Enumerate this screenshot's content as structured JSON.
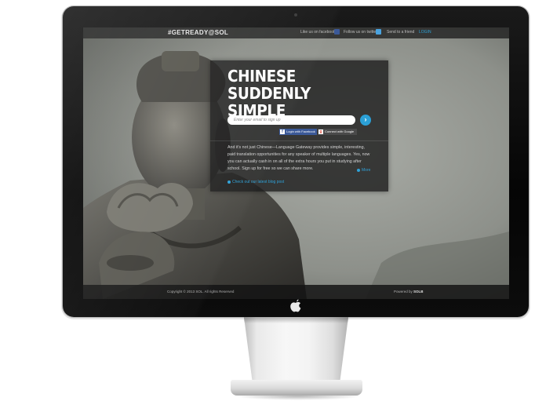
{
  "site": {
    "brand": "#GETREADY@SOL",
    "top_links": [
      {
        "label": "Like us on facebook",
        "icon": "facebook-icon"
      },
      {
        "label": "Follow us on twitter",
        "icon": "twitter-icon"
      },
      {
        "label": "Send to a friend",
        "icon": ""
      },
      {
        "label": "LOGIN",
        "icon": ""
      }
    ]
  },
  "hero": {
    "headline_line1": "CHINESE",
    "headline_line2": "SUDDENLY SIMPLE",
    "email_placeholder": "Enter your email to sign up",
    "submit_icon": "arrow-right-icon",
    "facebook_login": "Login with Facebook",
    "google_login": "Connect with Google",
    "description": "And it's not just Chinese—Language Gateway provides simple, interesting, paid translation opportunities for any speaker of multiple languages. Yes, now you can actually cash in on all of the extra hours you put in studying after school. Sign up for free so we can share more.",
    "more_link": "More",
    "blog_link": "Check out our latest blog post"
  },
  "footer": {
    "copyright": "Copyright © 2013     SOL. All rights Reserved",
    "powered_prefix": "Powered by",
    "powered_brand": "SOLB"
  },
  "colors": {
    "accent": "#2ea2d8",
    "facebook": "#3b5998",
    "twitter": "#4aa3df",
    "panel": "#1c1c1c"
  }
}
